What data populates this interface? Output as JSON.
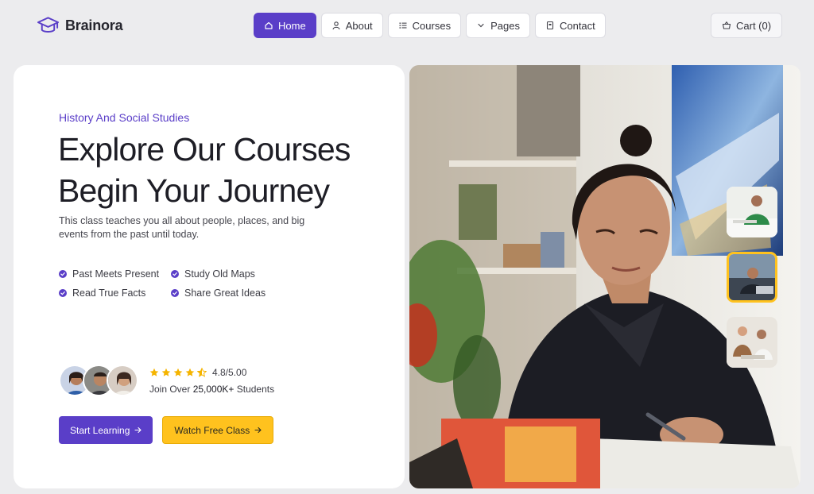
{
  "brand": {
    "name": "Brainora",
    "icon": "graduation-cap-icon"
  },
  "nav": {
    "items": [
      {
        "label": "Home",
        "icon": "home-icon",
        "active": true
      },
      {
        "label": "About",
        "icon": "user-icon",
        "active": false
      },
      {
        "label": "Courses",
        "icon": "list-icon",
        "active": false
      },
      {
        "label": "Pages",
        "icon": "chevron-down-icon",
        "active": false
      },
      {
        "label": "Contact",
        "icon": "contact-card-icon",
        "active": false
      }
    ],
    "cart_label": "Cart (0)",
    "cart_icon": "basket-icon"
  },
  "hero": {
    "eyebrow": "History And Social Studies",
    "headline_line1": "Explore Our Courses",
    "headline_line2": "Begin Your Journey",
    "description": "This class teaches you all about people, places, and big events from the past until today.",
    "features": [
      "Past Meets Present",
      "Study Old Maps",
      "Read True Facts",
      "Share Great Ideas"
    ],
    "rating": {
      "stars": 4.5,
      "value": "4.8/5.00"
    },
    "students_prefix": "Join Over ",
    "students_count": "25,000K+",
    "students_suffix": " Students",
    "primary_cta": "Start Learning",
    "secondary_cta": "Watch Free Class",
    "thumbnails_selected_index": 1
  },
  "colors": {
    "accent": "#5a3ec8",
    "cta_secondary": "#ffc21e",
    "background": "#ececee",
    "star": "#f5b400"
  }
}
